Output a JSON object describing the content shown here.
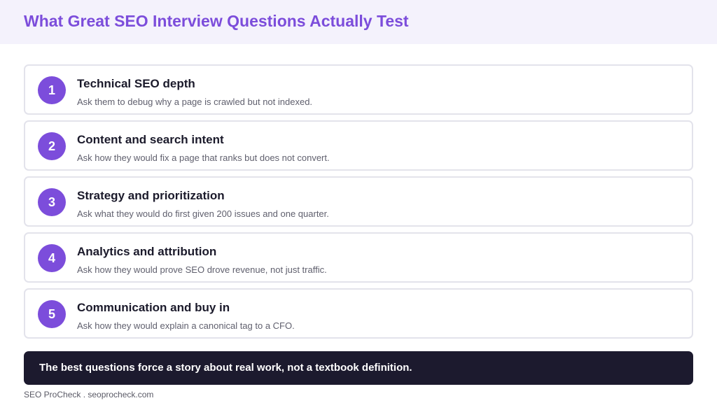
{
  "header": {
    "title": "What Great SEO Interview Questions Actually Test"
  },
  "items": [
    {
      "number": "1",
      "title": "Technical SEO depth",
      "description": "Ask them to debug why a page is crawled but not indexed."
    },
    {
      "number": "2",
      "title": "Content and search intent",
      "description": "Ask how they would fix a page that ranks but does not convert."
    },
    {
      "number": "3",
      "title": "Strategy and prioritization",
      "description": "Ask what they would do first given 200 issues and one quarter."
    },
    {
      "number": "4",
      "title": "Analytics and attribution",
      "description": "Ask how they would prove SEO drove revenue, not just traffic."
    },
    {
      "number": "5",
      "title": "Communication and buy in",
      "description": "Ask how they would explain a canonical tag to a CFO."
    }
  ],
  "callout": {
    "text": "The best questions force a story about real work, not a textbook definition."
  },
  "footer": {
    "text": "SEO ProCheck . seoprocheck.com"
  },
  "colors": {
    "accent": "#7c4ddb",
    "header_bg": "#f4f2fc",
    "callout_bg": "#1c1a2e",
    "card_border": "#e3e3eb"
  }
}
